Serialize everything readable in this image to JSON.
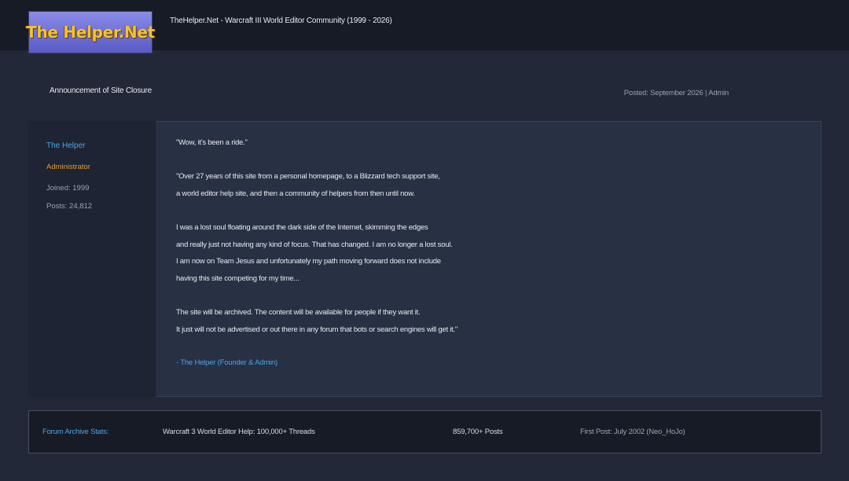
{
  "header": {
    "logo_text": "The Helper.Net",
    "site_title": "TheHelper.Net - Warcraft III World Editor Community (1999 - 2026)"
  },
  "announcement": {
    "title": "Announcement of Site Closure",
    "meta": "Posted: September 2026 | Admin"
  },
  "post": {
    "author": {
      "name": "The Helper",
      "role": "Administrator",
      "joined": "Joined: 1999",
      "posts": "Posts: 24,812"
    },
    "lines": [
      "\"Wow, it's been a ride.\"",
      "\"Over 27 years of this site from a personal homepage, to a Blizzard tech support site,",
      "a world editor help site, and then a community of helpers from then until now.",
      "I was a lost soul floating around the dark side of the Internet, skimming the edges",
      "and really just not having any kind of focus. That has changed. I am no longer a lost soul.",
      "I am now on Team Jesus and unfortunately my path moving forward does not include",
      "having this site competing for my time...",
      "The site will be archived. The content will be available for people if they want it.",
      "It just will not be advertised or out there in any forum that bots or search engines will get it.\""
    ],
    "signature": "- The Helper (Founder & Admin)"
  },
  "stats": {
    "label": "Forum Archive Stats:",
    "threads": "Warcraft 3 World Editor Help: 100,000+ Threads",
    "posts": "859,700+ Posts",
    "first_post": "First Post: July 2002 (Neo_HoJo)"
  },
  "colors": {
    "background": "#222838",
    "header_bg": "#171b26",
    "link_blue": "#4aa6e6",
    "role_orange": "#e39a2f",
    "logo_gold": "#f2c23a",
    "logo_purple": "#6e70d6"
  }
}
